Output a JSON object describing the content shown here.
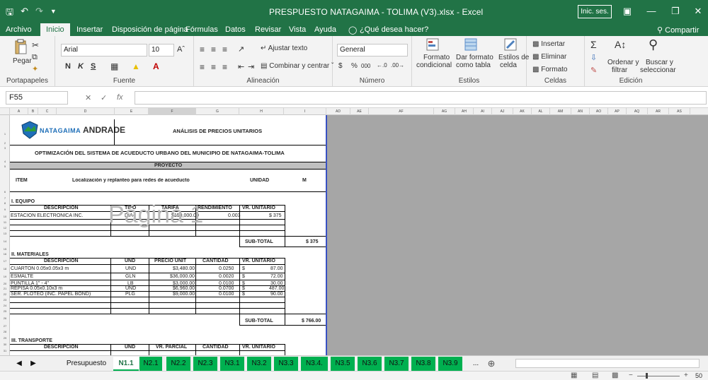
{
  "window": {
    "title": "PRESPUESTO NATAGAIMA - TOLIMA (V3).xlsx  -  Excel",
    "signin": "Inic. ses."
  },
  "tabs": [
    "Archivo",
    "Inicio",
    "Insertar",
    "Disposición de página",
    "Fórmulas",
    "Datos",
    "Revisar",
    "Vista",
    "Ayuda"
  ],
  "tell_me": "¿Qué desea hacer?",
  "share": "Compartir",
  "ribbon": {
    "clipboard": {
      "paste": "Pegar",
      "label": "Portapapeles"
    },
    "font": {
      "name": "Arial",
      "size": "10",
      "bold": "N",
      "italic": "K",
      "underline": "S",
      "label": "Fuente"
    },
    "alignment": {
      "wrap": "Ajustar texto",
      "merge": "Combinar y centrar",
      "label": "Alineación"
    },
    "number": {
      "format": "General",
      "percent": "%",
      "thousands": "000",
      "currency": "$",
      "label": "Número"
    },
    "styles": {
      "conditional1": "Formato",
      "conditional2": "condicional",
      "table1": "Dar formato",
      "table2": "como tabla",
      "cell1": "Estilos de",
      "cell2": "celda",
      "label": "Estilos"
    },
    "cells": {
      "insert": "Insertar",
      "delete": "Eliminar",
      "format": "Formato",
      "label": "Celdas"
    },
    "editing": {
      "sort1": "Ordenar y",
      "sort2": "filtrar",
      "find1": "Buscar y",
      "find2": "seleccionar",
      "label": "Edición"
    }
  },
  "formula_bar": {
    "name_box": "F55",
    "fx": "fx",
    "value": ""
  },
  "columns_left": [
    "A",
    "B",
    "C",
    "D",
    "E",
    "F",
    "G",
    "H",
    "I"
  ],
  "columns_right": [
    "AD",
    "AE",
    "AF",
    "AG",
    "AH",
    "AI",
    "AJ",
    "AK",
    "AL",
    "AM",
    "AN",
    "AO",
    "AP",
    "AQ",
    "AR",
    "AS"
  ],
  "rows": [
    "1",
    "2",
    "3",
    "4",
    "5",
    "6",
    "7",
    "8",
    "9",
    "10",
    "11",
    "12",
    "13",
    "14",
    "15",
    "16",
    "17",
    "18",
    "19",
    "20",
    "21",
    "22",
    "23",
    "24",
    "25",
    "26",
    "27",
    "28",
    "29",
    "30",
    "31"
  ],
  "document": {
    "logo_text": "NATAGAIMA",
    "logo_sub": "ANDRADE",
    "title": "ANÁLISIS DE PRECIOS UNITARIOS",
    "project_name": "OPTIMIZACIÓN DEL SISTEMA DE ACUEDUCTO URBANO DEL MUNICIPIO DE NATAGAIMA-TOLIMA",
    "project_label": "PROYECTO",
    "item_label": "ITEM",
    "item_desc": "Localización y replanteo para redes de acueducto",
    "unit_label": "UNIDAD",
    "unit_value": "M",
    "equipment": {
      "heading": "I. EQUIPO",
      "headers": [
        "DESCRIPCION",
        "TIPO",
        "TARIFA",
        "RENDIMIENTO",
        "VR. UNITARIO"
      ],
      "rows": [
        [
          "ESTACION ELECTRONICA INC.",
          "DIA",
          "$150,000.00",
          "0.003",
          "$ 375"
        ]
      ],
      "subtotal_label": "SUB-TOTAL",
      "subtotal": "$ 375"
    },
    "materials": {
      "heading": "II. MATERIALES",
      "headers": [
        "DESCRIPCION",
        "UND",
        "PRECIO UNIT",
        "CANTIDAD",
        "VR. UNITARIO"
      ],
      "rows": [
        [
          "CUARTON 0.05x0.05x3 m",
          "UND",
          "$3,480.00",
          "0.0250",
          "$",
          "87.00"
        ],
        [
          "ESMALTE",
          "GLN",
          "$36,000.00",
          "0.0020",
          "$",
          "72.00"
        ],
        [
          "PUNTILLA 1\" - 4\"",
          "LB",
          "$3,000.00",
          "0.0100",
          "$",
          "30.00"
        ],
        [
          "REPISA 0.05x0.10x3 m",
          "UND",
          "$6,960.00",
          "0.0700",
          "$",
          "487.00"
        ],
        [
          "SER. PLOTEO (INC. PAPEL BOND)",
          "PLG",
          "$9,000.00",
          "0.0100",
          "$",
          "90.00"
        ]
      ],
      "subtotal_label": "SUB-TOTAL",
      "subtotal": "$ 766.00"
    },
    "transport": {
      "heading": "III. TRANSPORTE",
      "headers": [
        "DESCRIPCION",
        "UND",
        "VR. PARCIAL",
        "CANTIDAD",
        "VR. UNITARIO"
      ]
    },
    "watermark": "Página 1"
  },
  "sheet_tabs": [
    "Presupuesto",
    "N1.1",
    "N2.1",
    "N2.2",
    "N2.3",
    "N3.1",
    "N3.2",
    "N3.3",
    "N3.4.",
    "N3.5",
    "N3.6",
    "N3.7",
    "N3.8",
    "N3.9",
    "..."
  ],
  "active_sheet": "N1.1",
  "status": {
    "zoom": "50"
  },
  "colors": {
    "excel_green": "#217346",
    "tab_green": "#00b050",
    "sheet_gray": "#a6a6a6",
    "page_border": "#3952c4"
  }
}
